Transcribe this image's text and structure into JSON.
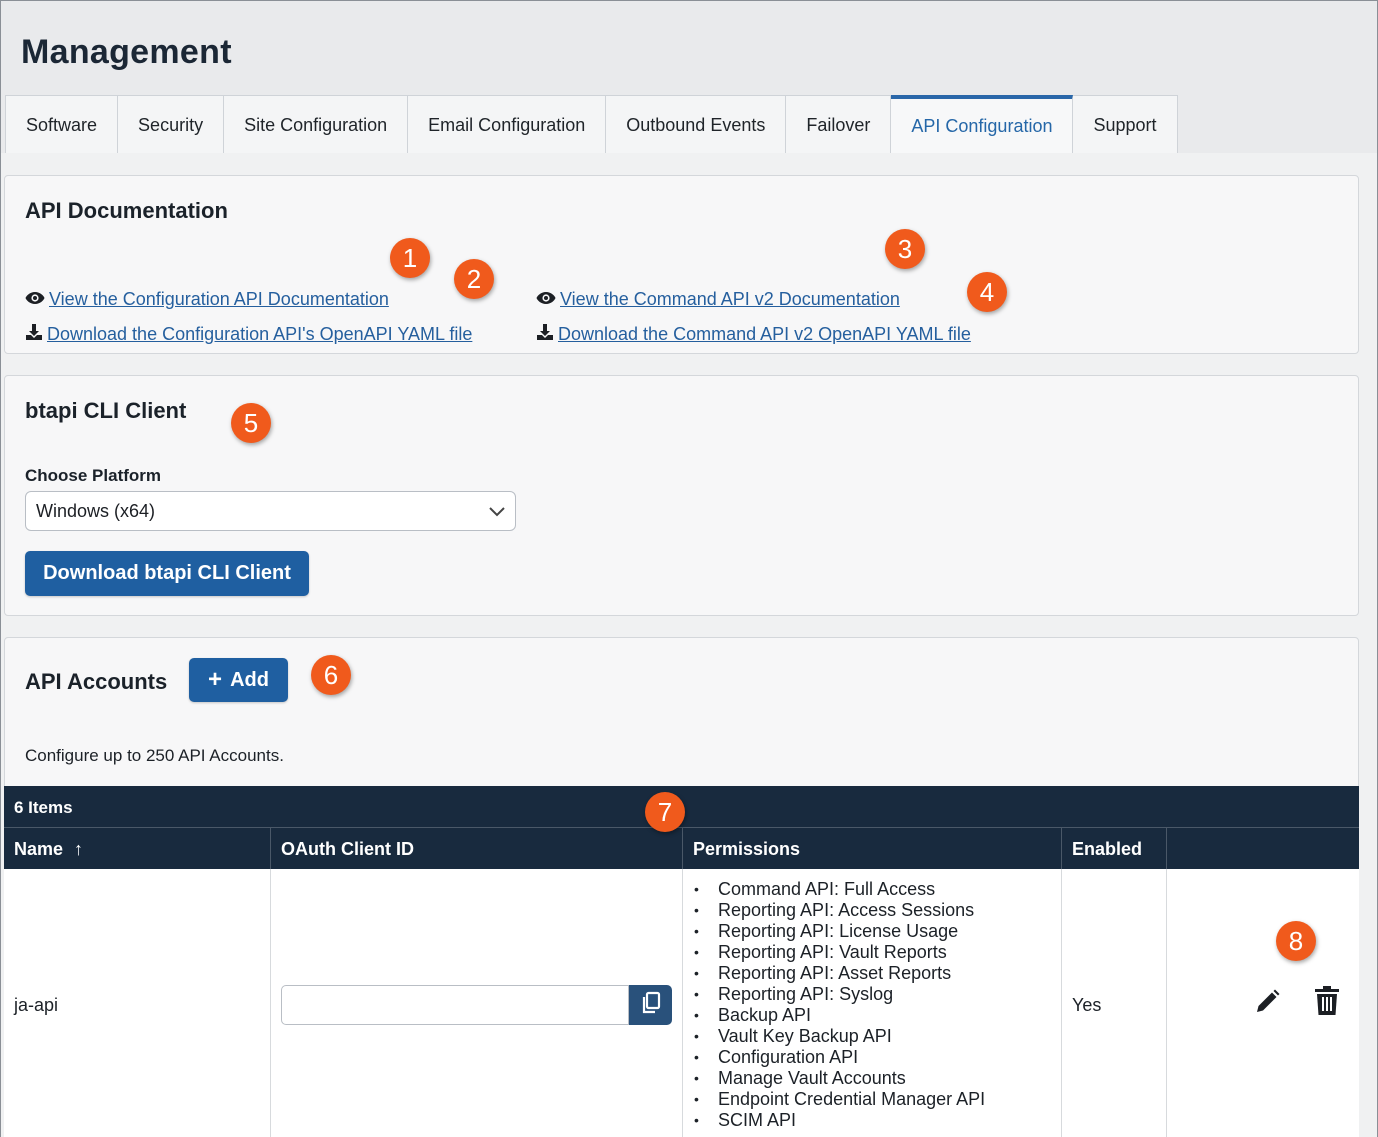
{
  "header": {
    "title": "Management"
  },
  "tabs": [
    {
      "label": "Software",
      "active": false
    },
    {
      "label": "Security",
      "active": false
    },
    {
      "label": "Site Configuration",
      "active": false
    },
    {
      "label": "Email Configuration",
      "active": false
    },
    {
      "label": "Outbound Events",
      "active": false
    },
    {
      "label": "Failover",
      "active": false
    },
    {
      "label": "API Configuration",
      "active": true
    },
    {
      "label": "Support",
      "active": false
    }
  ],
  "api_docs": {
    "title": "API Documentation",
    "view_config_link": "View the Configuration API Documentation",
    "download_config_link": "Download the Configuration API's OpenAPI YAML file",
    "view_command_link": "View the Command API v2 Documentation",
    "download_command_link": "Download the Command API v2 OpenAPI YAML file"
  },
  "cli": {
    "title": "btapi CLI Client",
    "platform_label": "Choose Platform",
    "platform_selected": "Windows (x64)",
    "download_button": "Download btapi CLI Client"
  },
  "accounts": {
    "title": "API Accounts",
    "add_button": "Add",
    "add_icon": "+",
    "helper_text": "Configure up to 250 API Accounts.",
    "item_count": "6 Items",
    "columns": {
      "name": "Name",
      "name_sort_icon": "↑",
      "oauth": "OAuth Client ID",
      "permissions": "Permissions",
      "enabled": "Enabled"
    },
    "rows": [
      {
        "name": "ja-api",
        "oauth_client_id": "",
        "enabled": "Yes",
        "permissions": [
          "Command API: Full Access",
          "Reporting API: Access Sessions",
          "Reporting API: License Usage",
          "Reporting API: Vault Reports",
          "Reporting API: Asset Reports",
          "Reporting API: Syslog",
          "Backup API",
          "Vault Key Backup API",
          "Configuration API",
          "Manage Vault Accounts",
          "Endpoint Credential Manager API",
          "SCIM API"
        ]
      }
    ]
  },
  "markers": [
    "1",
    "2",
    "3",
    "4",
    "5",
    "6",
    "7",
    "8"
  ],
  "colors": {
    "accent": "#1f5fa1",
    "marker": "#f05a1c",
    "grid_header": "#182a3e",
    "link": "#255f9e"
  },
  "icons": [
    "eye-icon",
    "download-icon",
    "chevron-down-icon",
    "copy-icon",
    "pencil-icon",
    "trash-icon"
  ]
}
